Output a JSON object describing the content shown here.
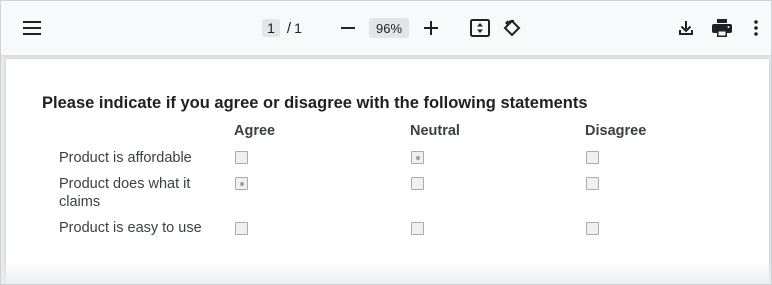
{
  "toolbar": {
    "page_current": "1",
    "page_separator": "/",
    "page_total": "1",
    "zoom": "96%"
  },
  "form": {
    "title": "Please indicate if you agree or disagree with the following statements",
    "columns": [
      "Agree",
      "Neutral",
      "Disagree"
    ],
    "rows": [
      {
        "label": "Product is affordable",
        "selected": "Neutral"
      },
      {
        "label": "Product does what it claims",
        "selected": "Agree"
      },
      {
        "label": "Product is easy to use",
        "selected": ""
      }
    ]
  }
}
